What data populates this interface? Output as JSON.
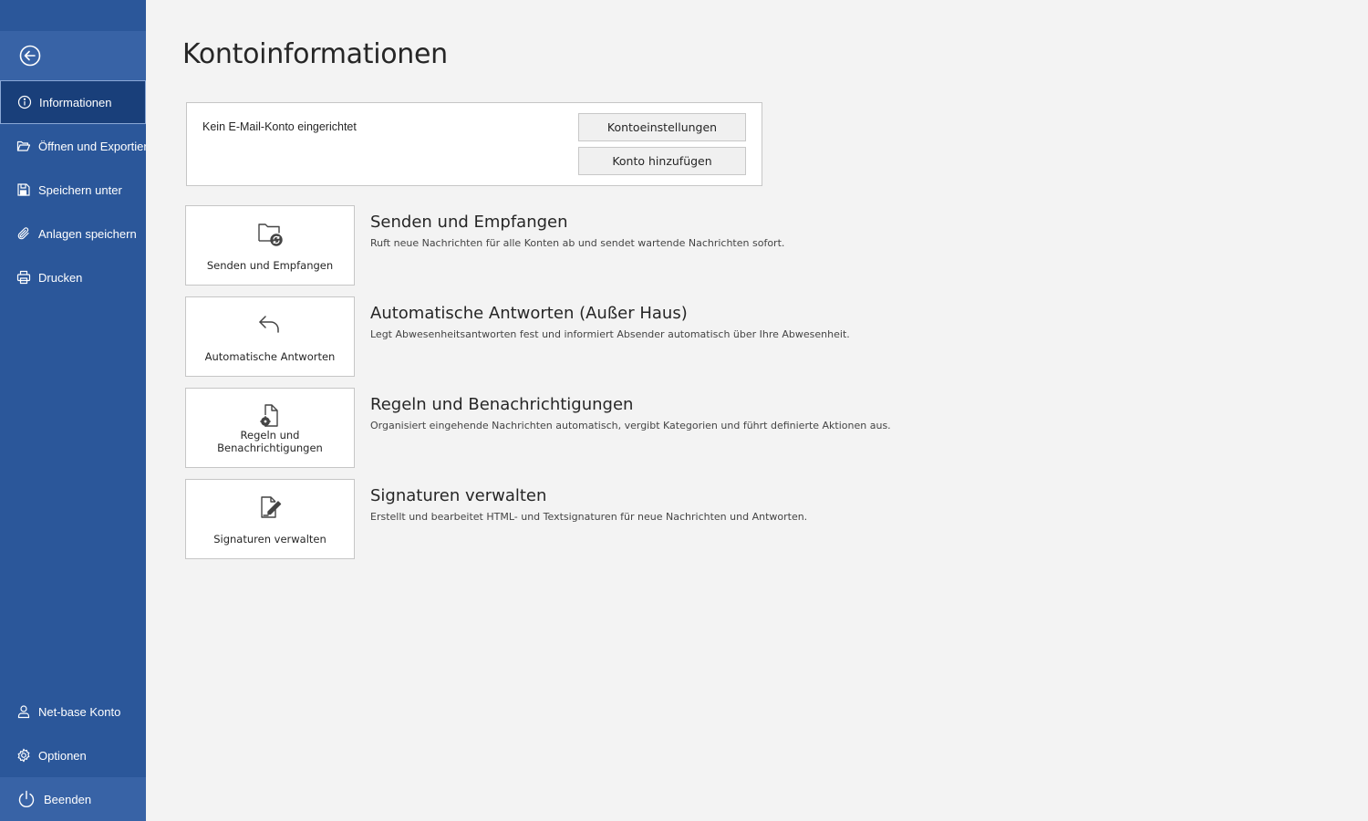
{
  "sidebar": {
    "items": [
      {
        "label": "Informationen",
        "icon": "info-icon"
      },
      {
        "label": "Öffnen und Exportieren",
        "icon": "folder-open-icon"
      },
      {
        "label": "Speichern unter",
        "icon": "save-as-icon"
      },
      {
        "label": "Anlagen speichern",
        "icon": "paperclip-icon"
      },
      {
        "label": "Drucken",
        "icon": "printer-icon"
      }
    ],
    "bottom": [
      {
        "label": "Net-base Konto",
        "icon": "person-icon"
      },
      {
        "label": "Optionen",
        "icon": "gear-icon"
      },
      {
        "label": "Beenden",
        "icon": "power-icon"
      }
    ]
  },
  "main": {
    "title": "Kontoinformationen",
    "account": {
      "status": "Kein E-Mail-Konto eingerichtet",
      "settings_button": "Kontoeinstellungen",
      "add_button": "Konto hinzufügen"
    },
    "tiles": [
      {
        "label": "Senden und Empfangen",
        "icon": "folder-sync-icon",
        "title": "Senden und Empfangen",
        "description": "Ruft neue Nachrichten für alle Konten ab und sendet wartende Nachrichten sofort."
      },
      {
        "label": "Automatische Antworten",
        "icon": "reply-arrow-icon",
        "title": "Automatische Antworten (Außer Haus)",
        "description": "Legt Abwesenheitsantworten fest und informiert Absender automatisch über Ihre Abwesenheit."
      },
      {
        "label": "Regeln und Benachrichtigungen",
        "icon": "rules-document-icon",
        "title": "Regeln und Benachrichtigungen",
        "description": "Organisiert eingehende Nachrichten automatisch, vergibt Kategorien und führt definierte Aktionen aus."
      },
      {
        "label": "Signaturen verwalten",
        "icon": "signature-icon",
        "title": "Signaturen verwalten",
        "description": "Erstellt und bearbeitet HTML- und Textsignaturen für neue Nachrichten und Antworten."
      }
    ]
  },
  "colors": {
    "sidebar_bg": "#2b579a",
    "sidebar_active": "#193f7a",
    "page_bg": "#f3f3f3"
  }
}
